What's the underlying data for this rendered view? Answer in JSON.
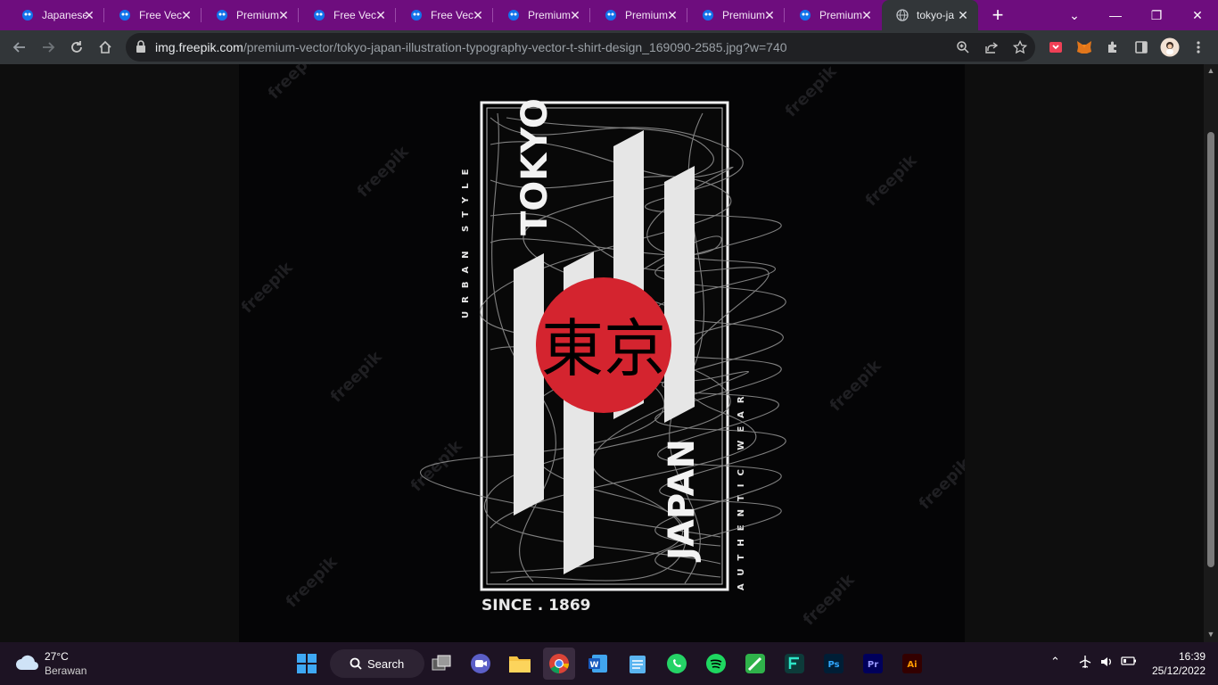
{
  "browser": {
    "tabs": [
      {
        "title": "Japanese",
        "icon": "freepik-icon"
      },
      {
        "title": "Free Vec",
        "icon": "freepik-icon"
      },
      {
        "title": "Premium",
        "icon": "freepik-icon"
      },
      {
        "title": "Free Vec",
        "icon": "freepik-icon"
      },
      {
        "title": "Free Vec",
        "icon": "freepik-icon"
      },
      {
        "title": "Premium",
        "icon": "freepik-icon"
      },
      {
        "title": "Premium",
        "icon": "freepik-icon"
      },
      {
        "title": "Premium",
        "icon": "freepik-icon"
      },
      {
        "title": "Premium",
        "icon": "freepik-icon"
      },
      {
        "title": "tokyo-ja",
        "icon": "globe-icon",
        "active": true
      }
    ],
    "url_host": "img.freepik.com",
    "url_path": "/premium-vector/tokyo-japan-illustration-typography-vector-t-shirt-design_169090-2585.jpg?w=740",
    "accent_color": "#6e0d7e"
  },
  "artwork": {
    "vertical_left": "URBAN STYLE",
    "vertical_right": "AUTHENTIC WEAR",
    "tokyo": "TOKYO",
    "japan": "JAPAN",
    "kanji": "東京",
    "since": "SINCE . 1869",
    "watermark": "freepik",
    "sun_color": "#d4242f"
  },
  "taskbar": {
    "weather_temp": "27°C",
    "weather_condition": "Berawan",
    "search_label": "Search",
    "time": "16:39",
    "date": "25/12/2022",
    "apps": [
      "task-view",
      "meet",
      "file-explorer",
      "chrome",
      "word",
      "notepad",
      "whatsapp",
      "spotify",
      "pen",
      "filmora",
      "photoshop",
      "premiere",
      "illustrator"
    ]
  }
}
